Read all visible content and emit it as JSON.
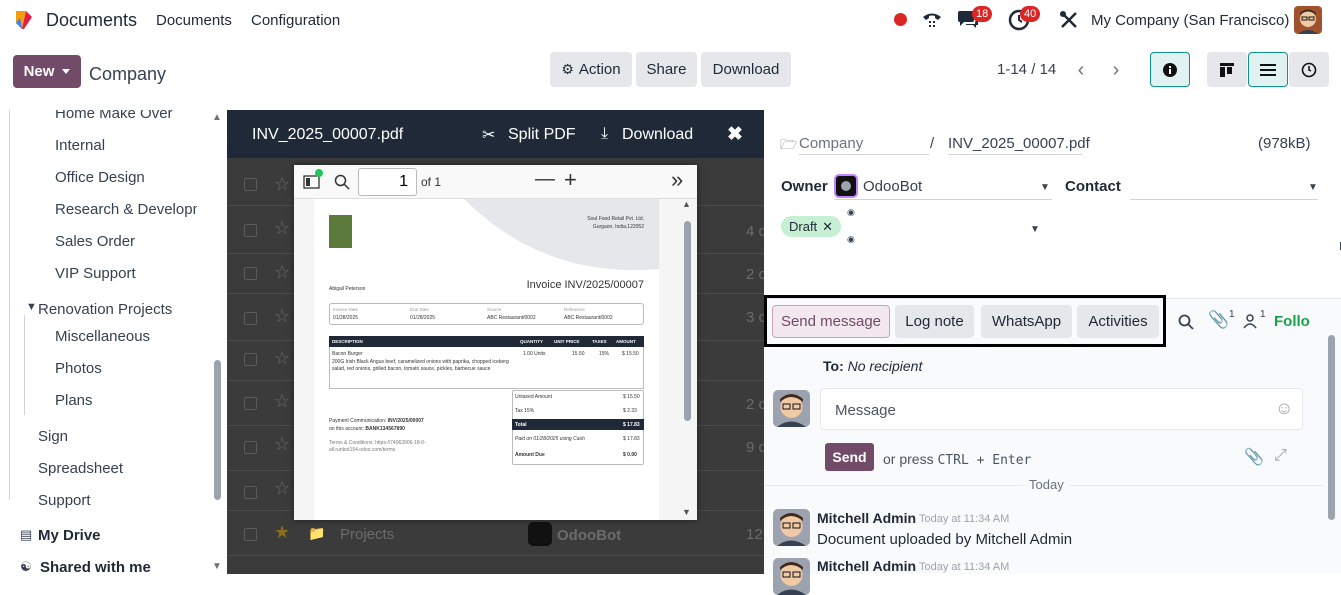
{
  "topbar": {
    "app_name": "Documents",
    "menu": [
      "Documents",
      "Configuration"
    ],
    "messages_badge": "18",
    "activities_badge": "40",
    "company": "My Company (San Francisco)"
  },
  "control": {
    "new_label": "New",
    "breadcrumb": "Company",
    "action_label": "Action",
    "share_label": "Share",
    "download_label": "Download",
    "pager": "1-14 / 14"
  },
  "sidebar": {
    "items": [
      {
        "label": "Home Make Over"
      },
      {
        "label": "Internal"
      },
      {
        "label": "Office Design"
      },
      {
        "label": "Research & Developm"
      },
      {
        "label": "Sales Order"
      },
      {
        "label": "VIP Support"
      },
      {
        "label": "Renovation Projects"
      },
      {
        "label": "Miscellaneous"
      },
      {
        "label": "Photos"
      },
      {
        "label": "Plans"
      },
      {
        "label": "Sign"
      },
      {
        "label": "Spreadsheet"
      },
      {
        "label": "Support"
      },
      {
        "label": "My Drive"
      },
      {
        "label": "Shared with me"
      }
    ]
  },
  "list": {
    "row_numbers": [
      "4 c",
      "2 c",
      "3 c",
      "2 c",
      "9 c",
      "12"
    ],
    "last_row_name": "Projects",
    "last_row_owner": "OdooBot"
  },
  "pdf": {
    "filename": "INV_2025_00007.pdf",
    "split_label": "Split PDF",
    "download_label": "Download",
    "page_value": "1",
    "page_of": "of 1",
    "doc": {
      "company_name": "Soul Food Retail Pvt. Ltd.",
      "company_addr": "Gurgaon, India,122052",
      "customer": "Abigail Peterson",
      "title": "Invoice INV/2025/00007",
      "meta_labels": [
        "Invoice Date",
        "Due Date",
        "Source",
        "Reference"
      ],
      "meta_values": [
        "01/28/2025",
        "01/28/2025",
        "ABC Restaurant/0002",
        "ABC Restaurant/0002"
      ],
      "table_headers": [
        "DESCRIPTION",
        "QUANTITY",
        "UNIT PRICE",
        "TAXES",
        "AMOUNT"
      ],
      "line_desc_title": "Bacon Burger",
      "line_desc": "200G Irish Black Angus beef, caramelized onions with paprika, chopped iceberg salad, red onions, grilled bacon, tomato sauce, pickles, barbecue sauce",
      "line_qty": "1.00 Units",
      "line_price": "15.50",
      "line_tax": "15%",
      "line_amount": "$ 15.50",
      "totals": [
        {
          "label": "Untaxed Amount",
          "value": "$ 15.50"
        },
        {
          "label": "Tax 15%",
          "value": "$ 2.33"
        },
        {
          "label": "Total",
          "value": "$ 17.83"
        },
        {
          "label": "Paid on 01/28/2025 using Cash",
          "value": "$ 17.83"
        },
        {
          "label": "Amount Due",
          "value": "$ 0.00"
        }
      ],
      "payment_comm_label": "Payment Communication:",
      "payment_comm_value": "INV/2025/00007",
      "account_label": "on this account:",
      "account_value": "BANK134567890",
      "terms": "Terms & Conditions: https://74063906-18-0-all.runbot154.odoo.com/terms"
    }
  },
  "details": {
    "folder": "Company",
    "separator": "/",
    "filename": "INV_2025_00007.pdf",
    "size": "(978kB)",
    "owner_label": "Owner",
    "owner_value": "OdooBot",
    "contact_label": "Contact",
    "tag": "Draft"
  },
  "chatter": {
    "tabs": [
      "Send message",
      "Log note",
      "WhatsApp",
      "Activities"
    ],
    "attachments_count": "1",
    "followers_count": "1",
    "follow_label": "Follo",
    "to_label": "To:",
    "to_value": "No recipient",
    "composer_placeholder": "Message",
    "send_label": "Send",
    "hint_prefix": "or press",
    "hint_keys": "CTRL + Enter",
    "day_separator": "Today",
    "messages": [
      {
        "author": "Mitchell Admin",
        "time": "Today at 11:34 AM",
        "body": "Document uploaded by Mitchell Admin"
      },
      {
        "author": "Mitchell Admin",
        "time": "Today at 11:34 AM",
        "body": ""
      }
    ]
  },
  "colors": {
    "brand": "#714b67",
    "highlight_border": "#000000",
    "follow_green": "#16a34a",
    "tag_bg": "#c7efd4"
  }
}
